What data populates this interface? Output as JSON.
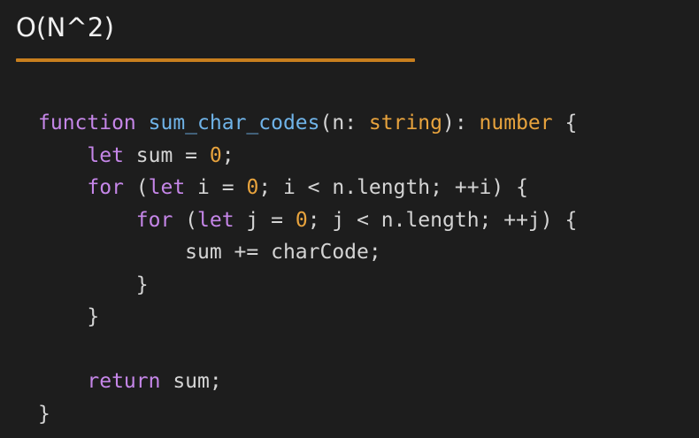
{
  "slide": {
    "title": "O(N^2)"
  },
  "colors": {
    "background": "#1d1d1d",
    "underline": "#c87f1e",
    "keyword": "#c586e8",
    "function": "#6fb3e8",
    "type": "#e8a33d",
    "plain": "#d4d4d4"
  },
  "code": {
    "language": "typescript",
    "lines": [
      [
        {
          "t": "function",
          "k": "keyword"
        },
        {
          "t": " ",
          "k": "plain"
        },
        {
          "t": "sum_char_codes",
          "k": "fn"
        },
        {
          "t": "(n: ",
          "k": "plain"
        },
        {
          "t": "string",
          "k": "type"
        },
        {
          "t": "): ",
          "k": "plain"
        },
        {
          "t": "number",
          "k": "type"
        },
        {
          "t": " {",
          "k": "plain"
        }
      ],
      [
        {
          "t": "    ",
          "k": "plain"
        },
        {
          "t": "let",
          "k": "keyword"
        },
        {
          "t": " sum = ",
          "k": "plain"
        },
        {
          "t": "0",
          "k": "number"
        },
        {
          "t": ";",
          "k": "plain"
        }
      ],
      [
        {
          "t": "    ",
          "k": "plain"
        },
        {
          "t": "for",
          "k": "keyword"
        },
        {
          "t": " (",
          "k": "plain"
        },
        {
          "t": "let",
          "k": "keyword"
        },
        {
          "t": " i = ",
          "k": "plain"
        },
        {
          "t": "0",
          "k": "number"
        },
        {
          "t": "; i < n.length; ++i) {",
          "k": "plain"
        }
      ],
      [
        {
          "t": "        ",
          "k": "plain"
        },
        {
          "t": "for",
          "k": "keyword"
        },
        {
          "t": " (",
          "k": "plain"
        },
        {
          "t": "let",
          "k": "keyword"
        },
        {
          "t": " j = ",
          "k": "plain"
        },
        {
          "t": "0",
          "k": "number"
        },
        {
          "t": "; j < n.length; ++j) {",
          "k": "plain"
        }
      ],
      [
        {
          "t": "            sum += charCode;",
          "k": "plain"
        }
      ],
      [
        {
          "t": "        }",
          "k": "plain"
        }
      ],
      [
        {
          "t": "    }",
          "k": "plain"
        }
      ],
      [
        {
          "t": "",
          "k": "plain"
        }
      ],
      [
        {
          "t": "    ",
          "k": "plain"
        },
        {
          "t": "return",
          "k": "keyword"
        },
        {
          "t": " sum;",
          "k": "plain"
        }
      ],
      [
        {
          "t": "}",
          "k": "plain"
        }
      ]
    ]
  }
}
